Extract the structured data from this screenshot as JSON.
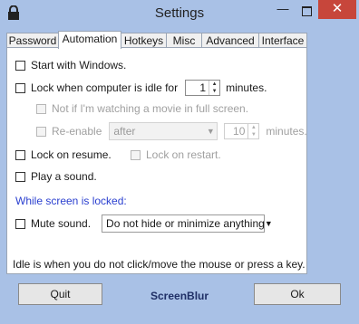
{
  "window": {
    "title": "Settings",
    "icon": "lock-icon",
    "minimize": "—",
    "close": "✕"
  },
  "tabs": [
    {
      "label": "Password"
    },
    {
      "label": "Automation",
      "active": true
    },
    {
      "label": "Hotkeys"
    },
    {
      "label": "Misc"
    },
    {
      "label": "Advanced"
    },
    {
      "label": "Interface"
    }
  ],
  "automation": {
    "start_with_windows": {
      "label": "Start with Windows.",
      "checked": false
    },
    "lock_idle": {
      "label_before": "Lock when computer is idle for",
      "value": "1",
      "label_after": "minutes.",
      "checked": false
    },
    "not_movie": {
      "label": "Not if I'm watching a movie in full screen.",
      "checked": false,
      "disabled": true
    },
    "reenable": {
      "label": "Re-enable",
      "select_value": "after",
      "spin_value": "10",
      "unit": "minutes.",
      "checked": false,
      "disabled": true
    },
    "lock_on_resume": {
      "label": "Lock on resume.",
      "checked": false
    },
    "lock_on_restart": {
      "label": "Lock on restart.",
      "checked": false,
      "disabled": true
    },
    "play_sound": {
      "label": "Play a sound.",
      "checked": false
    },
    "while_locked_heading": "While screen is locked:",
    "mute_sound": {
      "label": "Mute sound.",
      "checked": false
    },
    "hide_select": {
      "value": "Do not hide or minimize anything"
    },
    "idle_note": "Idle is when you do not click/move the mouse or press a key."
  },
  "footer": {
    "quit": "Quit",
    "brand": "ScreenBlur",
    "ok": "Ok"
  },
  "colors": {
    "accent_section": "#2a3fcf",
    "close_button": "#c7463b",
    "frame": "#a9c1e6"
  }
}
